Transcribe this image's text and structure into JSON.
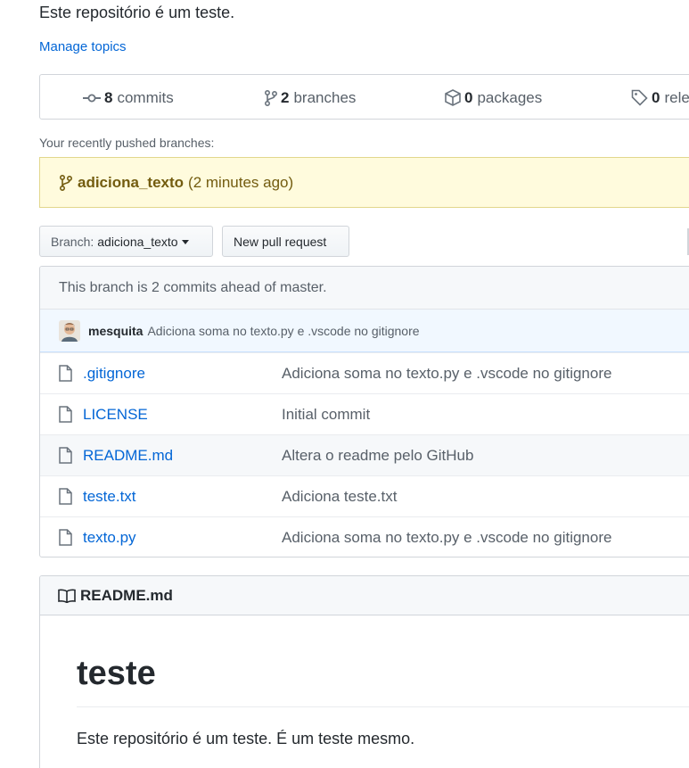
{
  "repo": {
    "description": "Este repositório é um teste.",
    "manage_topics": "Manage topics"
  },
  "stats": {
    "commits": {
      "count": "8",
      "label": "commits",
      "icon": "commit-icon"
    },
    "branches": {
      "count": "2",
      "label": "branches",
      "icon": "branch-icon"
    },
    "packages": {
      "count": "0",
      "label": "packages",
      "icon": "package-icon"
    },
    "releases": {
      "count": "0",
      "label": "rele",
      "icon": "tag-icon"
    }
  },
  "recent": {
    "label": "Your recently pushed branches:",
    "branch": "adiciona_texto",
    "time": "(2 minutes ago)"
  },
  "toolbar": {
    "branch_label": "Branch:",
    "branch_value": "adiciona_texto",
    "new_pr": "New pull request"
  },
  "files": {
    "ahead_text": "This branch is 2 commits ahead of master.",
    "latest_commit": {
      "author": "mesquita",
      "message": "Adiciona soma no texto.py e .vscode no gitignore"
    },
    "rows": [
      {
        "name": ".gitignore",
        "message": "Adiciona soma no texto.py e .vscode no gitignore"
      },
      {
        "name": "LICENSE",
        "message": "Initial commit"
      },
      {
        "name": "README.md",
        "message": "Altera o readme pelo GitHub"
      },
      {
        "name": "teste.txt",
        "message": "Adiciona teste.txt"
      },
      {
        "name": "texto.py",
        "message": "Adiciona soma no texto.py e .vscode no gitignore"
      }
    ]
  },
  "readme": {
    "title": "README.md",
    "heading": "teste",
    "body": "Este repositório é um teste. É um teste mesmo."
  },
  "colors": {
    "link": "#0366d6",
    "banner_bg": "#fffbdd",
    "banner_text": "#735c0f",
    "commit_bar": "#f1f8ff"
  }
}
